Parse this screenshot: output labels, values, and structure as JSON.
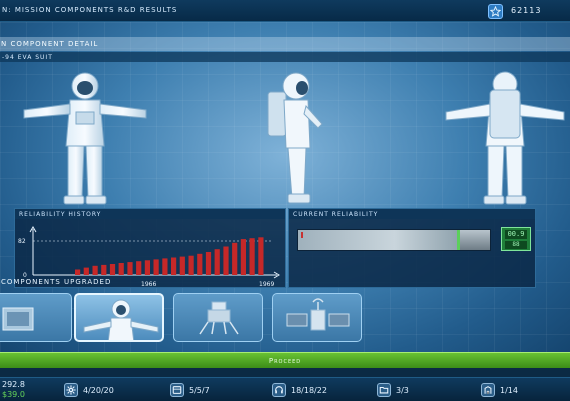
{
  "topbar": {
    "title": "n: Mission Components R&D Results",
    "score": "62113",
    "star_icon": "star-icon"
  },
  "section": {
    "title": "n Component Detail",
    "suit_name": "-94 EVA suit"
  },
  "reliability_history": {
    "label": "Reliability History",
    "chart_data": {
      "type": "bar",
      "title": "Reliability History",
      "y_tick": "82",
      "y_zero": "0",
      "x_ticks": [
        "1966",
        "1969"
      ],
      "values": [
        12,
        16,
        20,
        22,
        24,
        26,
        28,
        30,
        32,
        34,
        36,
        38,
        40,
        42,
        46,
        50,
        56,
        62,
        70,
        78,
        80,
        82
      ],
      "ylim": [
        0,
        100
      ],
      "color": "#c62828"
    }
  },
  "current_reliability": {
    "label": "Current Reliability",
    "gauge_level": 0.84,
    "readout_top": "00.9",
    "readout_bottom": "88"
  },
  "components": {
    "label": "Components Upgraded"
  },
  "proceed": {
    "label": "Proceed"
  },
  "bottombar": {
    "money_top": "292.8",
    "money_bottom": "$39.0",
    "stats": [
      {
        "value": "4/20/20",
        "icon": "gear-icon"
      },
      {
        "value": "5/5/7",
        "icon": "box-icon"
      },
      {
        "value": "18/18/22",
        "icon": "headset-icon"
      },
      {
        "value": "3/3",
        "icon": "folder-icon"
      },
      {
        "value": "1/14",
        "icon": "building-icon"
      }
    ]
  }
}
